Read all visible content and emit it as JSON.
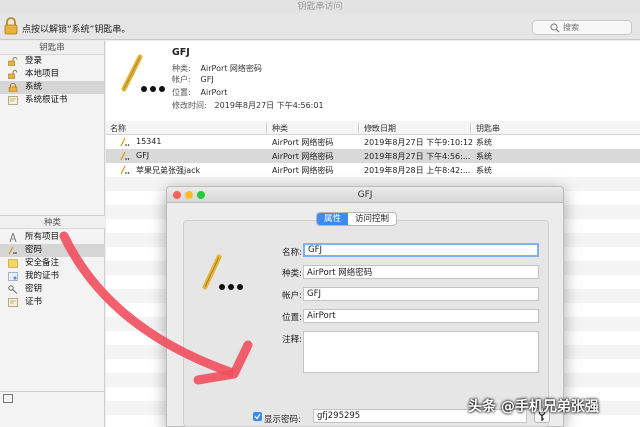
{
  "window": {
    "title": "钥匙串访问"
  },
  "toolbar": {
    "unlock_text": "点按以解锁“系统”钥匙串。",
    "search_placeholder": "搜索"
  },
  "sidebar": {
    "keychains_header": "钥匙串",
    "keychains": [
      {
        "label": "登录",
        "icon": "lock-open-icon"
      },
      {
        "label": "本地项目",
        "icon": "lock-open-icon"
      },
      {
        "label": "系统",
        "icon": "lock-icon",
        "selected": true
      },
      {
        "label": "系统根证书",
        "icon": "certificate-icon"
      }
    ],
    "categories_header": "种类",
    "categories": [
      {
        "label": "所有项目",
        "icon": "all-items-icon"
      },
      {
        "label": "密码",
        "icon": "password-icon",
        "selected": true
      },
      {
        "label": "安全备注",
        "icon": "note-icon"
      },
      {
        "label": "我的证书",
        "icon": "my-cert-icon"
      },
      {
        "label": "密钥",
        "icon": "key-icon"
      },
      {
        "label": "证书",
        "icon": "certificate-icon"
      }
    ]
  },
  "detail": {
    "title": "GFJ",
    "kind_label": "种类:",
    "kind_value": "AirPort 网络密码",
    "account_label": "帐户:",
    "account_value": "GFJ",
    "where_label": "位置:",
    "where_value": "AirPort",
    "modified_label": "修改时间:",
    "modified_value": "2019年8月27日 下午4:56:01"
  },
  "table": {
    "columns": [
      "名称",
      "种类",
      "修改日期",
      "钥匙串"
    ],
    "rows": [
      {
        "name": "15341",
        "kind": "AirPort 网络密码",
        "date": "2019年8月27日 下午9:10:12",
        "keychain": "系统"
      },
      {
        "name": "GFJ",
        "kind": "AirPort 网络密码",
        "date": "2019年8月27日 下午4:56:...",
        "keychain": "系统",
        "selected": true
      },
      {
        "name": "苹果兄弟张强jack",
        "kind": "AirPort 网络密码",
        "date": "2019年8月28日 上午8:42:...",
        "keychain": "系统"
      }
    ]
  },
  "dialog": {
    "title": "GFJ",
    "tabs": [
      "属性",
      "访问控制"
    ],
    "name_label": "名称:",
    "name_value": "GFJ",
    "kind_label": "种类:",
    "kind_value": "AirPort 网络密码",
    "account_label": "帐户:",
    "account_value": "GFJ",
    "where_label": "位置:",
    "where_value": "AirPort",
    "comments_label": "注释:",
    "comments_value": "",
    "show_password_label": "显示密码:",
    "password_value": "gfj295295",
    "show_password_checked": true
  },
  "watermark": "头条 @手机兄弟张强",
  "colors": {
    "accent": "#3b8cf0",
    "arrow": "#ef4f5c",
    "close": "#fc5f57",
    "minimize": "#fdbc2e",
    "zoom": "#28c840"
  }
}
